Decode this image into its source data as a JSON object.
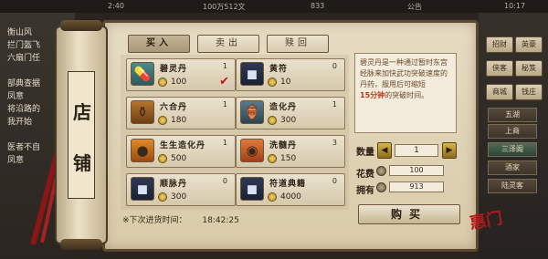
{
  "status_bar": {
    "left_value": "2:40",
    "money": "100万512文",
    "gold": "833",
    "mail": "公告",
    "time": "10:17"
  },
  "left_chat": {
    "lines": [
      "衡山风",
      "拦门盔飞",
      "六扇门任",
      "部典查据",
      "凤意",
      "将沿路的",
      "我开始",
      "医者不自",
      "凤意"
    ]
  },
  "right_menu": {
    "buttons": [
      "招财",
      "英豪",
      "侠客",
      "秘笈",
      "商城",
      "钱庄"
    ],
    "tabs": [
      "五湖",
      "上商",
      "三泽阁",
      "酒家",
      "陆灵客"
    ]
  },
  "scroll": {
    "title_chars": [
      "店",
      "铺"
    ]
  },
  "shop": {
    "tabs": [
      {
        "label": "买入",
        "active": true
      },
      {
        "label": "卖出",
        "active": false
      },
      {
        "label": "赎回",
        "active": false
      }
    ],
    "items": [
      {
        "name": "碧灵丹",
        "qty": "1",
        "price": "100",
        "icon": "jade-pill-icon",
        "selected": true
      },
      {
        "name": "黄符",
        "qty": "0",
        "price": "10",
        "icon": "sealed-talisman-icon",
        "selected": false
      },
      {
        "name": "六合丹",
        "qty": "1",
        "price": "180",
        "icon": "gourd-bottle-icon",
        "selected": false
      },
      {
        "name": "造化丹",
        "qty": "1",
        "price": "300",
        "icon": "elixir-jar-icon",
        "selected": false
      },
      {
        "name": "生生造化丹",
        "qty": "1",
        "price": "500",
        "icon": "pill-pile-icon",
        "selected": false
      },
      {
        "name": "洗髓丹",
        "qty": "3",
        "price": "150",
        "icon": "pill-dish-icon",
        "selected": false
      },
      {
        "name": "顺脉丹",
        "qty": "0",
        "price": "300",
        "icon": "sealed-talisman-icon",
        "selected": false
      },
      {
        "name": "符道典籍",
        "qty": "0",
        "price": "4000",
        "icon": "sealed-talisman-icon",
        "selected": false
      }
    ],
    "restock_label": "※下次进货时间：",
    "restock_time": "18:42:25",
    "description": {
      "text_before": "碧灵丹是一种通过暂时东宫经脉来加快武功突破速度的丹药，服用后可缩短",
      "highlight": "15分钟",
      "text_after": "的突破时间。"
    },
    "quantity_label": "数量",
    "quantity_value": "1",
    "cost_label": "花费",
    "cost_value": "100",
    "owned_label": "拥有",
    "owned_value": "913",
    "buy_label": "购买"
  },
  "brand_stamp": "惠门"
}
